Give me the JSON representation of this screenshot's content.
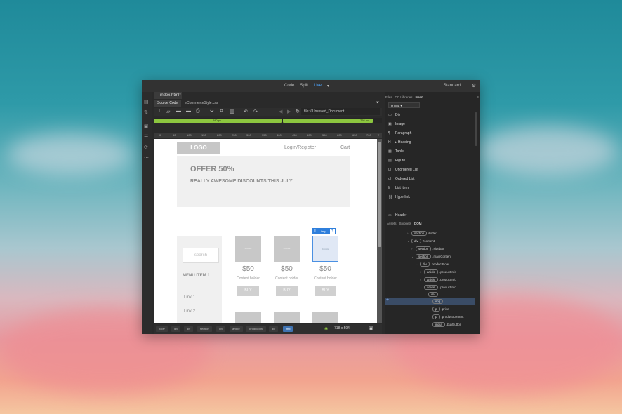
{
  "colors": {
    "accent": "#4ea6ff",
    "media_query": "#8cc63f",
    "selection": "#2f7fdc"
  },
  "topbar": {
    "views": [
      "Code",
      "Split",
      "Live"
    ],
    "active_view": "Live",
    "workspace": "Standard"
  },
  "document": {
    "tab": "index.html*",
    "sub_tabs": [
      "Source Code",
      "eCommerceStyle.css"
    ],
    "url": "file:///Unsaved_Document"
  },
  "media_queries": {
    "first": "480 px",
    "second": "768 px"
  },
  "ruler": {
    "ticks": [
      "0",
      "50",
      "100",
      "150",
      "200",
      "250",
      "300",
      "350",
      "400",
      "450",
      "500",
      "550",
      "600",
      "650",
      "700"
    ]
  },
  "page": {
    "logo": "LOGO",
    "login": "Login/Register",
    "cart": "Cart",
    "hero_title": "OFFER 50%",
    "hero_subtitle": "REALLY AWESOME DISCOUNTS THIS JULY",
    "search_placeholder": "search",
    "menu_item": "MENU ITEM 1",
    "links": [
      "Link 1",
      "Link 2"
    ],
    "products": [
      {
        "image_label": "IMAGE",
        "price": "$50",
        "holder": "Content holder",
        "buy": "BUY"
      },
      {
        "image_label": "IMAGE",
        "price": "$50",
        "holder": "Content holder",
        "buy": "BUY"
      },
      {
        "image_label": "IMAGE",
        "price": "$50",
        "holder": "Content holder",
        "buy": "BUY"
      }
    ],
    "selected_tag": "img"
  },
  "statusbar": {
    "breadcrumbs": [
      "body",
      "div",
      "div",
      "section",
      "div",
      "article",
      ".productInfo",
      "div",
      "img"
    ],
    "size": "718 x 594"
  },
  "right_panel": {
    "tabs": [
      "Files",
      "CC Libraries",
      "Insert"
    ],
    "active_tab": "Insert",
    "category": "HTML",
    "insert_items": [
      {
        "icon": "div-icon",
        "glyph": "▭",
        "label": "Div"
      },
      {
        "icon": "image-icon",
        "glyph": "▣",
        "label": "Image"
      },
      {
        "icon": "paragraph-icon",
        "glyph": "¶",
        "label": "Paragraph"
      },
      {
        "icon": "heading-icon",
        "glyph": "H",
        "label": "Heading"
      },
      {
        "icon": "table-icon",
        "glyph": "▦",
        "label": "Table"
      },
      {
        "icon": "figure-icon",
        "glyph": "▤",
        "label": "Figure"
      },
      {
        "icon": "unordered-list-icon",
        "glyph": "ul",
        "label": "Unordered List"
      },
      {
        "icon": "ordered-list-icon",
        "glyph": "ol",
        "label": "Ordered List"
      },
      {
        "icon": "list-item-icon",
        "glyph": "li",
        "label": "List Item"
      },
      {
        "icon": "hyperlink-icon",
        "glyph": "⛓",
        "label": "Hyperlink"
      },
      {
        "icon": "header-icon",
        "glyph": "▭",
        "label": "Header"
      }
    ],
    "bottom_tabs": [
      "Assets",
      "Snippets",
      "DOM"
    ],
    "active_bottom_tab": "DOM",
    "dom": [
      {
        "tag": "section",
        "label": "#offer"
      },
      {
        "tag": "div",
        "label": "#content"
      },
      {
        "tag": "section",
        "label": ".sidebar"
      },
      {
        "tag": "section",
        "label": ".mainContent"
      },
      {
        "tag": "div",
        "label": ".productRow"
      },
      {
        "tag": "article",
        "label": ".productInfo"
      },
      {
        "tag": "article",
        "label": ".productInfo"
      },
      {
        "tag": "article",
        "label": ".productInfo"
      },
      {
        "tag": "div",
        "label": ""
      },
      {
        "tag": "img",
        "label": ""
      },
      {
        "tag": "p",
        "label": ".price"
      },
      {
        "tag": "p",
        "label": ".productContent"
      },
      {
        "tag": "input",
        "label": ".buyButton"
      }
    ]
  }
}
